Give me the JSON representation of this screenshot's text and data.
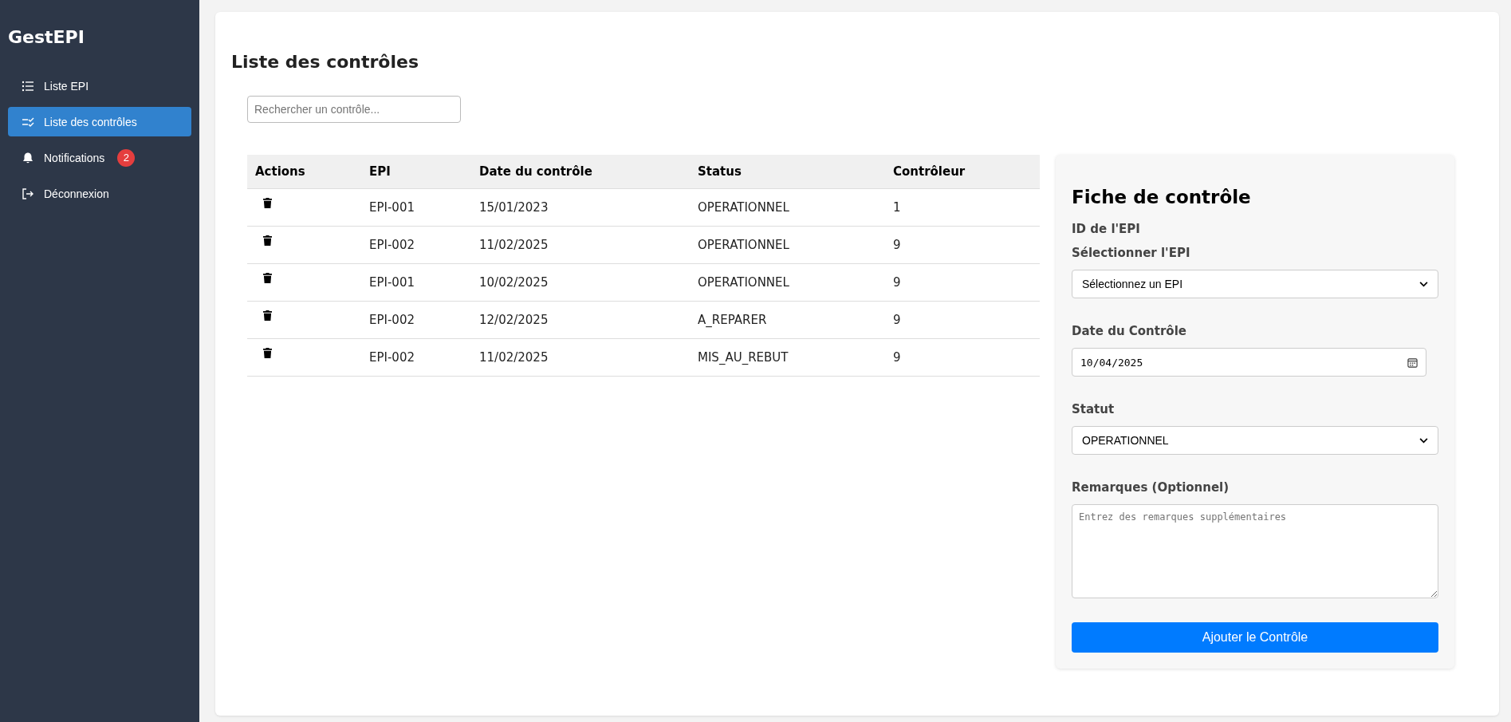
{
  "sidebar": {
    "logo": "GestEPI",
    "items": [
      {
        "label": "Liste EPI",
        "selected": false
      },
      {
        "label": "Liste des contrôles",
        "selected": true
      },
      {
        "label": "Notifications",
        "selected": false,
        "badge": "2"
      },
      {
        "label": "Déconnexion",
        "selected": false
      }
    ]
  },
  "page_title": "Liste des contrôles",
  "search": {
    "placeholder": "Rechercher un contrôle..."
  },
  "table": {
    "columns": [
      "Actions",
      "EPI",
      "Date du contrôle",
      "Status",
      "Contrôleur"
    ],
    "rows": [
      {
        "epi": "EPI-001",
        "date": "15/01/2023",
        "status": "OPERATIONNEL",
        "controller": "1"
      },
      {
        "epi": "EPI-002",
        "date": "11/02/2025",
        "status": "OPERATIONNEL",
        "controller": "9"
      },
      {
        "epi": "EPI-001",
        "date": "10/02/2025",
        "status": "OPERATIONNEL",
        "controller": "9"
      },
      {
        "epi": "EPI-002",
        "date": "12/02/2025",
        "status": "A_REPARER",
        "controller": "9"
      },
      {
        "epi": "EPI-002",
        "date": "11/02/2025",
        "status": "MIS_AU_REBUT",
        "controller": "9"
      }
    ]
  },
  "form": {
    "title": "Fiche de contrôle",
    "id_label": "ID de l'EPI",
    "epi_label": "Sélectionner l'EPI",
    "epi_value": "Sélectionnez un EPI",
    "date_label": "Date du Contrôle",
    "date_value": "10/04/2025",
    "status_label": "Statut",
    "status_value": "OPERATIONNEL",
    "remarks_label": "Remarques (Optionnel)",
    "remarks_placeholder": "Entrez des remarques supplémentaires",
    "submit": "Ajouter le Contrôle"
  }
}
